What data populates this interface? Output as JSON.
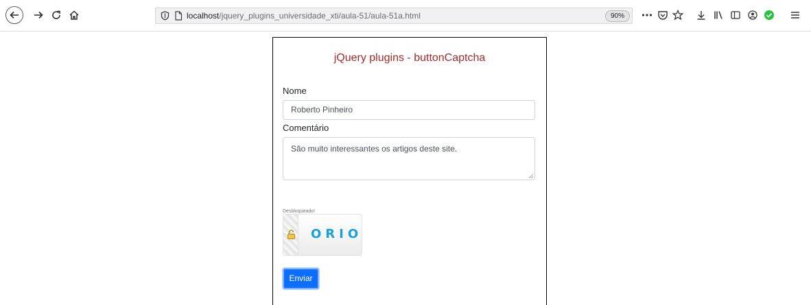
{
  "browser": {
    "url_host": "localhost",
    "url_path": "/jquery_plugins_universidade_xti/aula-51/aula-51a.html",
    "zoom": "90%",
    "icons": [
      "back-arrow-icon",
      "forward-arrow-icon",
      "reload-icon",
      "home-icon",
      "shield-icon",
      "page-icon",
      "more-icon",
      "pocket-icon",
      "star-icon",
      "download-icon",
      "library-icon",
      "sidebar-icon",
      "account-icon",
      "extension-check-icon",
      "menu-icon"
    ],
    "colors": {
      "check_extension": "#2ac23e"
    }
  },
  "page": {
    "title": "jQuery plugins - buttonCaptcha",
    "title_color": "#a52a2a",
    "name_label": "Nome",
    "name_value": "Roberto Pinheiro",
    "comment_label": "Comentário",
    "comment_value": "São muito interessantes os artigos deste site.",
    "captcha": {
      "status": "Desbloqueado!",
      "word": "ORION",
      "word_color": "#1aa0d8",
      "icon": "unlocked-padlock-icon"
    },
    "submit_label": "Enviar",
    "submit_color": "#0d6efd"
  }
}
